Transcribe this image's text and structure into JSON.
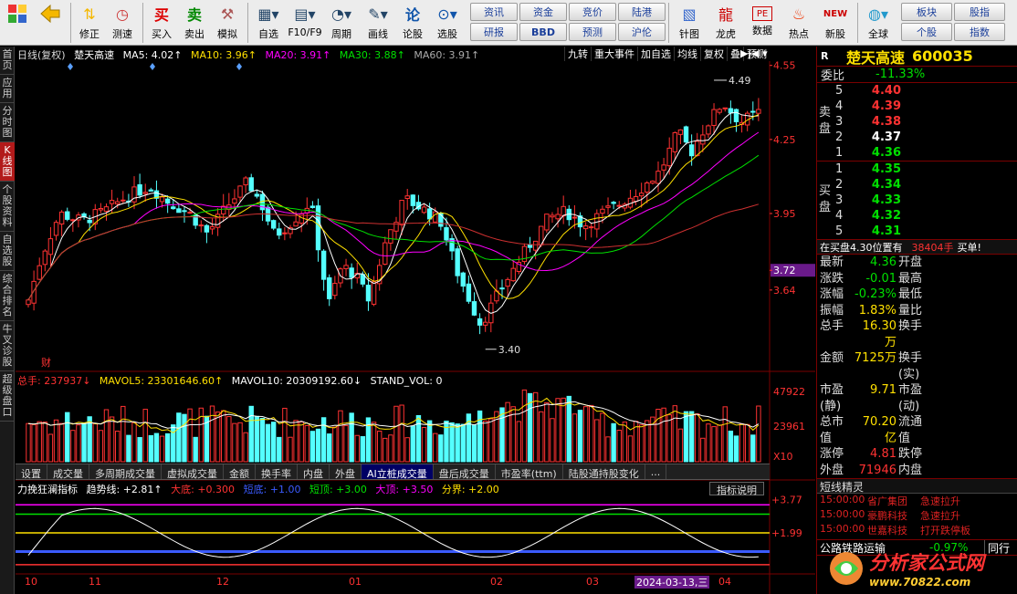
{
  "toolbar": {
    "items": [
      {
        "label": "",
        "icon": "grid-icon"
      },
      {
        "label": "",
        "icon": "back-arrow-icon"
      },
      {
        "label": "修正",
        "icon": "up-down-arrows-icon"
      },
      {
        "label": "测速",
        "icon": "clock-icon"
      },
      {
        "label": "买入",
        "icon": "buy-icon"
      },
      {
        "label": "卖出",
        "icon": "sell-icon"
      },
      {
        "label": "模拟",
        "icon": "hammer-icon"
      },
      {
        "label": "自选",
        "icon": "watchlist-icon"
      },
      {
        "label": "F10/F9",
        "icon": "f10-icon"
      },
      {
        "label": "周期",
        "icon": "period-icon"
      },
      {
        "label": "画线",
        "icon": "pencil-icon"
      },
      {
        "label": "论股",
        "icon": "discuss-icon"
      },
      {
        "label": "选股",
        "icon": "screener-icon"
      }
    ],
    "pills": [
      "资讯",
      "资金",
      "竞价",
      "陆港",
      "研报",
      "BBD",
      "预测",
      "沪伦"
    ],
    "right_items": [
      {
        "label": "针图",
        "icon": "chart-icon"
      },
      {
        "label": "龙虎",
        "icon": "dragon-icon"
      },
      {
        "label": "数据",
        "icon": "pe-icon"
      },
      {
        "label": "热点",
        "icon": "hot-icon"
      },
      {
        "label": "新股",
        "icon": "new-stock-icon"
      },
      {
        "label": "全球",
        "icon": "globe-icon"
      }
    ],
    "right_pills": [
      "板块",
      "股指",
      "个股",
      "指数"
    ]
  },
  "left_tabs": [
    "首页",
    "应用",
    "分时图",
    "K线图",
    "个股资料",
    "自选股",
    "综合排名",
    "牛叉诊股",
    "超级盘口"
  ],
  "left_tab_active": 3,
  "header": {
    "mode": "日线(复权)",
    "stock": "楚天高速",
    "ma5": "MA5: 4.02↑",
    "ma10": "MA10: 3.96↑",
    "ma20": "MA20: 3.91↑",
    "ma30": "MA30: 3.88↑",
    "ma60": "MA60: 3.91↑"
  },
  "chart_toolbar": [
    "九转",
    "重大事件",
    "加自选",
    "均线",
    "复权",
    "叠",
    "预测"
  ],
  "price_axis": {
    "ticks": [
      "4.55",
      "4.25",
      "3.95",
      "3.72",
      "3.64"
    ],
    "high_label": "4.49",
    "low_label": "3.40",
    "cai_label": "财"
  },
  "volume": {
    "header_total": "总手: 237937↓",
    "mavol5": "MAVOL5: 23301646.60↑",
    "mavol10": "MAVOL10: 20309192.60↓",
    "stand": "STAND_VOL: 0",
    "ticks": [
      "47922",
      "23961",
      "X10"
    ]
  },
  "indicator_tabs": [
    "设置",
    "成交量",
    "多周期成交量",
    "虚拟成交量",
    "金额",
    "换手率",
    "内盘",
    "外盘",
    "AI立桩成交量",
    "盘后成交量",
    "市盈率(ttm)",
    "陆股通持股变化",
    "..."
  ],
  "indicator_active": 8,
  "indicator": {
    "name": "力挽狂澜指标",
    "trend": "趋势线: +2.81↑",
    "dadi": "大底: +0.300",
    "duandi": "短底: +1.00",
    "duanding": "短顶: +3.00",
    "dading": "大顶: +3.50",
    "fenjie": "分界: +2.00",
    "help": "指标说明",
    "ticks": [
      "+3.77",
      "+1.99"
    ]
  },
  "date_axis": {
    "labels": [
      "10",
      "11",
      "12",
      "01",
      "02",
      "03",
      "04"
    ],
    "cursor": "2024-03-13,三"
  },
  "quote": {
    "name": "楚天高速",
    "code": "600035",
    "r_label": "R",
    "weibi_label": "委比",
    "weibi_value": "-11.33%",
    "sell_side": "卖盘",
    "buy_side": "买盘",
    "asks": [
      {
        "lv": "5",
        "px": "4.40"
      },
      {
        "lv": "4",
        "px": "4.39"
      },
      {
        "lv": "3",
        "px": "4.38"
      },
      {
        "lv": "2",
        "px": "4.37"
      },
      {
        "lv": "1",
        "px": "4.36"
      }
    ],
    "bids": [
      {
        "lv": "1",
        "px": "4.35"
      },
      {
        "lv": "2",
        "px": "4.34"
      },
      {
        "lv": "3",
        "px": "4.33"
      },
      {
        "lv": "4",
        "px": "4.32"
      },
      {
        "lv": "5",
        "px": "4.31"
      }
    ],
    "trade_msg": "在买盘4.30位置有",
    "trade_qty": "38404手",
    "trade_tag": "买单!",
    "fields": [
      {
        "k": "最新",
        "v": "4.36",
        "k2": "开盘",
        "v2": ""
      },
      {
        "k": "涨跌",
        "v": "-0.01",
        "k2": "最高",
        "v2": ""
      },
      {
        "k": "涨幅",
        "v": "-0.23%",
        "k2": "最低",
        "v2": ""
      },
      {
        "k": "振幅",
        "v": "1.83%",
        "k2": "量比",
        "v2": ""
      },
      {
        "k": "总手",
        "v": "16.30万",
        "k2": "换手",
        "v2": ""
      },
      {
        "k": "金额",
        "v": "7125万",
        "k2": "换手(实)",
        "v2": ""
      },
      {
        "k": "市盈(静)",
        "v": "9.71",
        "k2": "市盈(动)",
        "v2": ""
      },
      {
        "k": "总市值",
        "v": "70.20亿",
        "k2": "流通值",
        "v2": ""
      },
      {
        "k": "涨停",
        "v": "4.81",
        "k2": "跌停",
        "v2": ""
      },
      {
        "k": "外盘",
        "v": "71946",
        "k2": "内盘",
        "v2": ""
      }
    ]
  },
  "news": {
    "title": "短线精灵",
    "rows": [
      {
        "t": "15:00:00",
        "s": "省广集团",
        "e": "急速拉升"
      },
      {
        "t": "15:00:00",
        "s": "豪鹏科技",
        "e": "急速拉升"
      },
      {
        "t": "15:00:00",
        "s": "世嘉科技",
        "e": "打开跌停板"
      }
    ]
  },
  "sector": {
    "name": "公路铁路运输",
    "chg": "-0.97%",
    "tag": "同行"
  },
  "logo": {
    "cn": "分析家公式网",
    "url": "www.70822.com"
  },
  "colors": {
    "up": "#ff3232",
    "down": "#54ffff",
    "ma5": "#ffffff",
    "ma10": "#ffe000",
    "ma20": "#ff00ff",
    "ma30": "#00e000",
    "ma60": "#888888",
    "accent": "#b21a1a"
  }
}
